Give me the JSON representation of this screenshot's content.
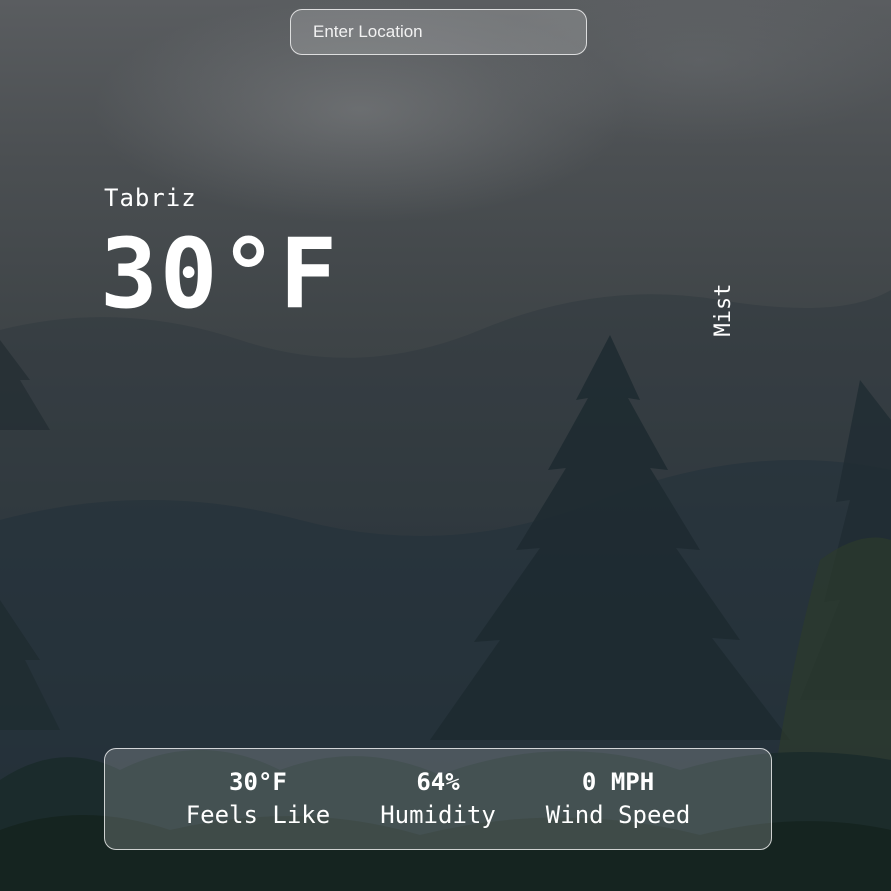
{
  "search": {
    "placeholder": "Enter Location"
  },
  "weather": {
    "city": "Tabriz",
    "temperature": "30°F",
    "condition": "Mist"
  },
  "stats": [
    {
      "value": "30°F",
      "label": "Feels Like"
    },
    {
      "value": "64%",
      "label": "Humidity"
    },
    {
      "value": "0 MPH",
      "label": "Wind Speed"
    }
  ]
}
